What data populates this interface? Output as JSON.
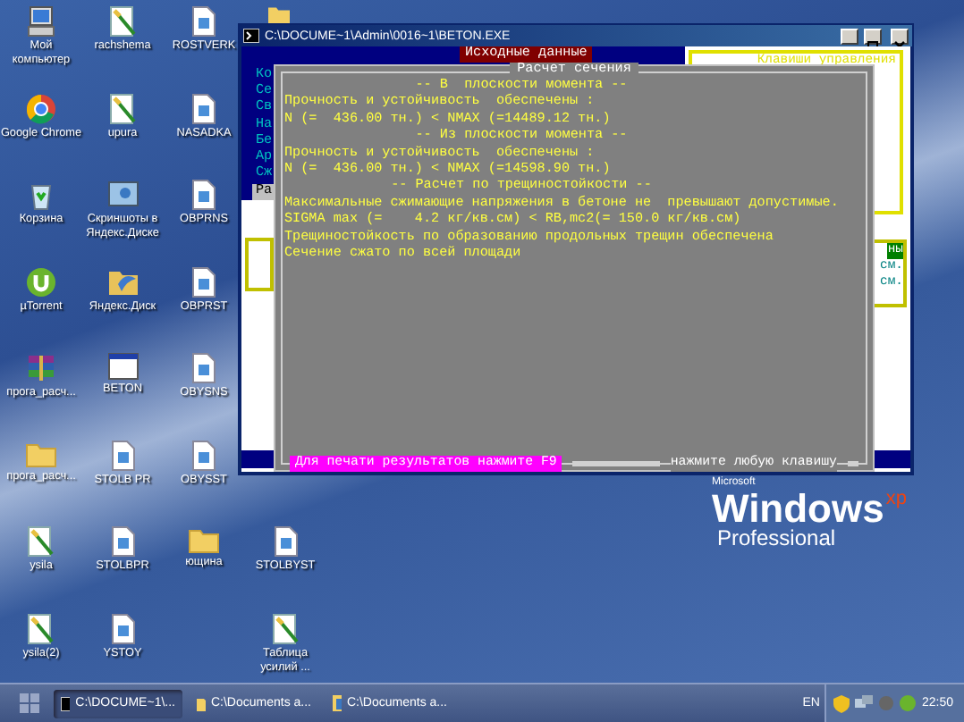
{
  "desktop": {
    "icons": [
      {
        "label": "Мой компьютер",
        "kind": "computer"
      },
      {
        "label": "Google Chrome",
        "kind": "chrome"
      },
      {
        "label": "Корзина",
        "kind": "recycle"
      },
      {
        "label": "µTorrent",
        "kind": "torrent"
      },
      {
        "label": "прога_расч...",
        "kind": "archive"
      },
      {
        "label": "прога_расч...",
        "kind": "folder"
      },
      {
        "label": "ysila",
        "kind": "paint"
      },
      {
        "label": "ysila(2)",
        "kind": "paint"
      },
      {
        "label": "rachshema",
        "kind": "paint"
      },
      {
        "label": "upura",
        "kind": "paint"
      },
      {
        "label": "Скриншоты в Яндекс.Диске",
        "kind": "screenshots"
      },
      {
        "label": "Яндекс.Диск",
        "kind": "yadisk"
      },
      {
        "label": "BETON",
        "kind": "app"
      },
      {
        "label": "STOLB PR",
        "kind": "document"
      },
      {
        "label": "STOLBPR",
        "kind": "document"
      },
      {
        "label": "YSTOY",
        "kind": "document"
      },
      {
        "label": "ROSTVERK",
        "kind": "document"
      },
      {
        "label": "NASADKA",
        "kind": "document"
      },
      {
        "label": "OBPRNS",
        "kind": "document"
      },
      {
        "label": "OBPRST",
        "kind": "document"
      },
      {
        "label": "OBYSNS",
        "kind": "document"
      },
      {
        "label": "OBYSST",
        "kind": "document"
      },
      {
        "label": "ющина",
        "kind": "folder"
      },
      {
        "label": "STOLBYST",
        "kind": "document"
      },
      {
        "label": "Таблица усилий ...",
        "kind": "paint"
      }
    ],
    "wallpaper_logo": {
      "maker": "Microsoft",
      "product": "Windows",
      "edition_mark": "xp",
      "edition": "Professional"
    }
  },
  "console": {
    "title": "C:\\DOCUME~1\\Admin\\0016~1\\BETON.EXE",
    "input_panel": {
      "title": "Исходные данные",
      "fragments": [
        "Ко",
        "Се",
        "Св",
        "На",
        "Бе",
        "Ар",
        "Сж"
      ],
      "button": "Ра"
    },
    "keys_panel": {
      "title": "Клавиши управления"
    },
    "side_fragments": [
      {
        "text": "ны",
        "kind": "highlight"
      },
      {
        "text": "см.",
        "kind": "plain"
      },
      {
        "text": "см.",
        "kind": "plain"
      }
    ],
    "dialog": {
      "title": "Расчет сечения",
      "lines": [
        {
          "text": "-- В  плоскости момента --",
          "kind": "heading"
        },
        {
          "text": "Прочность и устойчивость  обеспечены :",
          "kind": "text"
        },
        {
          "text": "N (=  436.00 тн.) < NMAX (=14489.12 тн.)",
          "kind": "text"
        },
        {
          "text": "-- Из плоскости момента --",
          "kind": "heading"
        },
        {
          "text": "Прочность и устойчивость  обеспечены :",
          "kind": "text"
        },
        {
          "text": "N (=  436.00 тн.) < NMAX (=14598.90 тн.)",
          "kind": "text"
        },
        {
          "text": "-- Расчет по трещиностойкости --",
          "kind": "heading"
        },
        {
          "text": "Максимальные сжимающие напряжения в бетоне не  превышают допустимые.",
          "kind": "text"
        },
        {
          "text": "SIGMA max (=    4.2 кг/кв.см) < RB,mc2(= 150.0 кг/кв.см)",
          "kind": "text"
        },
        {
          "text": "Трещиностойкость по образованию продольных трещин обеспечена",
          "kind": "text"
        },
        {
          "text": "Сечение сжато по всей площади",
          "kind": "text"
        }
      ],
      "print_hint": "Для печати результатов нажмите F9",
      "continue_hint": "нажмите любую клавишу"
    }
  },
  "taskbar": {
    "tasks": [
      {
        "label": "C:\\DOCUME~1\\...",
        "kind": "console",
        "selected": true
      },
      {
        "label": "C:\\Documents a...",
        "kind": "folder",
        "selected": false
      },
      {
        "label": "C:\\Documents a...",
        "kind": "explorer",
        "selected": false
      }
    ],
    "language": "EN",
    "clock": "22:50"
  }
}
